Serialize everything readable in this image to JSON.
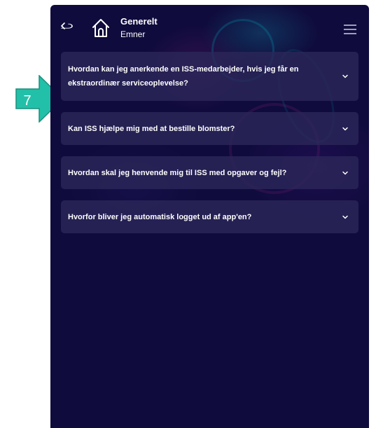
{
  "header": {
    "title": "Generelt",
    "subtitle": "Emner",
    "back_icon": "back-arrow-icon",
    "home_icon": "home-icon",
    "menu_icon": "hamburger-menu-icon"
  },
  "faq": {
    "items": [
      {
        "question": "Hvordan kan jeg anerkende en ISS-medarbejder, hvis jeg får en ekstraordinær serviceoplevelse?"
      },
      {
        "question": "Kan ISS hjælpe mig med at bestille blomster?"
      },
      {
        "question": "Hvordan skal jeg henvende mig til ISS med opgaver og fejl?"
      },
      {
        "question": "Hvorfor bliver jeg automatisk logget ud af app'en?"
      }
    ],
    "chevron_icon": "chevron-down-icon"
  },
  "annotation": {
    "label": "7",
    "color": "#22c0a8"
  },
  "colors": {
    "panel_background": "#0f0b3c",
    "item_background": "#2c285a",
    "text": "#ffffff"
  }
}
